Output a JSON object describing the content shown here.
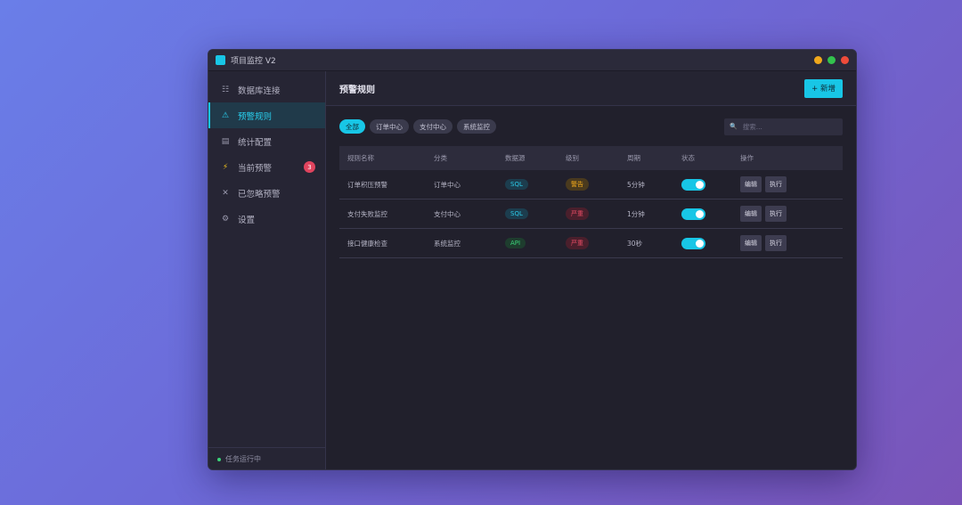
{
  "window": {
    "title": "项目监控 V2"
  },
  "sidebar": {
    "items": [
      {
        "label": "数据库连接",
        "icon": "list-icon"
      },
      {
        "label": "预警规则",
        "icon": "warning-icon",
        "active": true
      },
      {
        "label": "统计配置",
        "icon": "table-icon"
      },
      {
        "label": "当前预警",
        "icon": "lightning-icon",
        "badge": "3"
      },
      {
        "label": "已忽略预警",
        "icon": "close-icon"
      },
      {
        "label": "设置",
        "icon": "gear-icon"
      }
    ],
    "status": "任务运行中"
  },
  "main": {
    "title": "预警规则",
    "add_label": "+ 新增",
    "filters": [
      "全部",
      "订单中心",
      "支付中心",
      "系统监控"
    ],
    "active_filter": "全部",
    "search": {
      "placeholder": "搜索..."
    },
    "table": {
      "headers": [
        "规则名称",
        "分类",
        "数据源",
        "级别",
        "周期",
        "状态",
        "操作"
      ],
      "rows": [
        {
          "name": "订单积压预警",
          "category": "订单中心",
          "source": "SQL",
          "level": "警告",
          "period": "5分钟",
          "enabled": true
        },
        {
          "name": "支付失败监控",
          "category": "支付中心",
          "source": "SQL",
          "level": "严重",
          "period": "1分钟",
          "enabled": true
        },
        {
          "name": "接口健康检查",
          "category": "系统监控",
          "source": "API",
          "level": "严重",
          "period": "30秒",
          "enabled": true
        }
      ],
      "actions": {
        "edit": "编辑",
        "run": "执行"
      }
    }
  },
  "colors": {
    "accent": "#18c6e6",
    "warning": "#f0a81c",
    "critical": "#e74b64",
    "ok": "#3bd37a"
  }
}
